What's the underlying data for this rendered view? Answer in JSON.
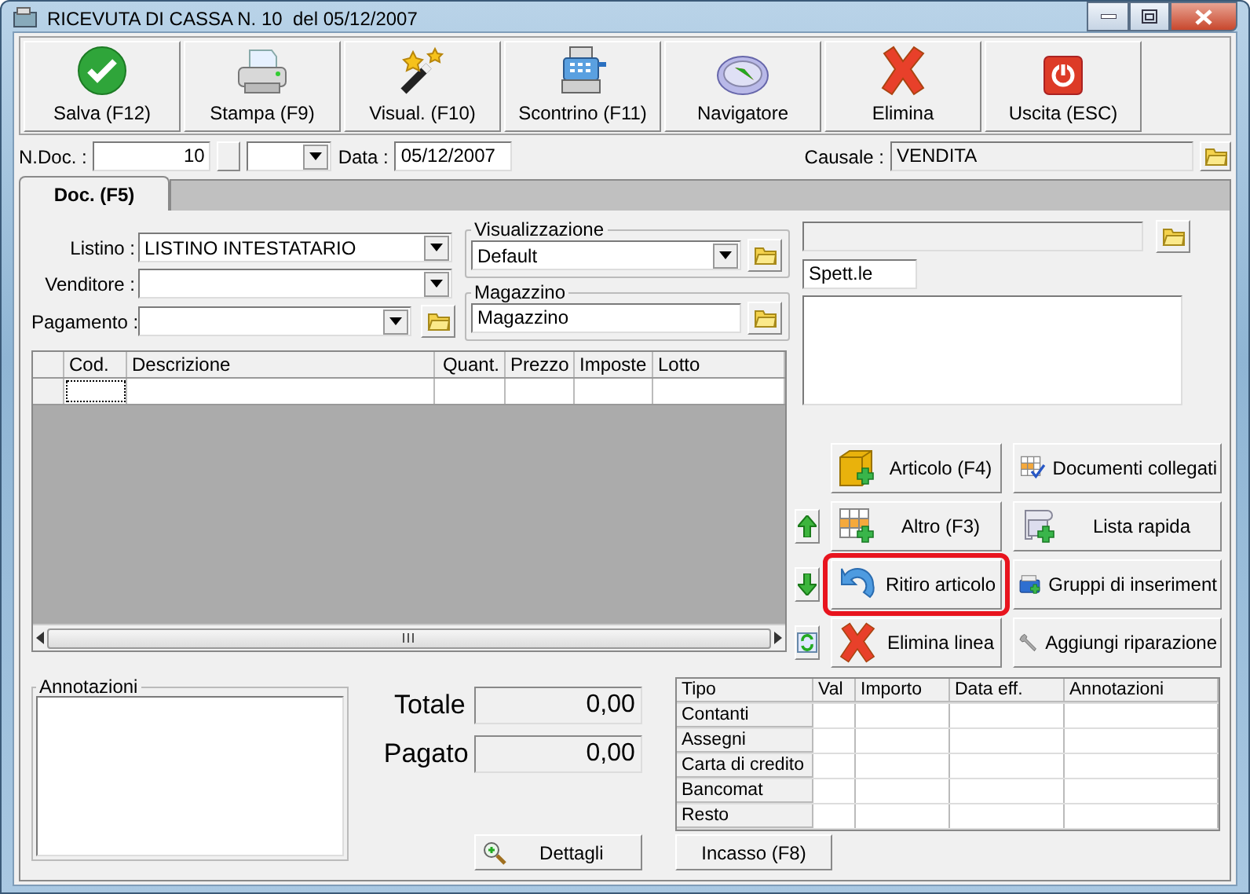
{
  "window": {
    "title": "RICEVUTA DI CASSA N. 10  del 05/12/2007"
  },
  "toolbar": [
    {
      "label": "Salva (F12)"
    },
    {
      "label": "Stampa (F9)"
    },
    {
      "label": "Visual. (F10)"
    },
    {
      "label": "Scontrino (F11)"
    },
    {
      "label": "Navigatore"
    },
    {
      "label": "Elimina"
    },
    {
      "label": "Uscita (ESC)"
    }
  ],
  "header": {
    "ndoc_label": "N.Doc. :",
    "ndoc_value": "10",
    "data_label": "Data :",
    "data_value": "05/12/2007",
    "causale_label": "Causale :",
    "causale_value": "VENDITA"
  },
  "tabs": [
    {
      "label": "Doc. (F5)",
      "selected": true
    }
  ],
  "form": [
    {
      "label": "Listino :",
      "value": "LISTINO INTESTATARIO",
      "folder": false
    },
    {
      "label": "Venditore :",
      "folder": false
    },
    {
      "label": "Pagamento :",
      "folder": true
    }
  ],
  "visualizzazione": {
    "title": "Visualizzazione",
    "value": "Default"
  },
  "magazzino": {
    "title": "Magazzino",
    "value": "Magazzino"
  },
  "recipient": {
    "salutation": "Spett.le"
  },
  "grid": {
    "columns": [
      "Cod.",
      "Descrizione",
      "Quant.",
      "Prezzo",
      "Imposte",
      "Lotto"
    ]
  },
  "actions": [
    {
      "label": "Articolo (F4)",
      "highlighted": false
    },
    {
      "label": "Documenti collegati",
      "highlighted": false
    },
    {
      "label": "Altro (F3)",
      "highlighted": false
    },
    {
      "label": "Lista rapida",
      "highlighted": false
    },
    {
      "label": "Ritiro articolo",
      "highlighted": true
    },
    {
      "label": "Gruppi di inseriment",
      "highlighted": false
    },
    {
      "label": "Elimina linea",
      "highlighted": false
    },
    {
      "label": "Aggiungi riparazione",
      "highlighted": false
    }
  ],
  "annotations": {
    "title": "Annotazioni"
  },
  "totals": [
    {
      "label": "Totale",
      "value": "0,00"
    },
    {
      "label": "Pagato",
      "value": "0,00"
    }
  ],
  "details_button": "Dettagli",
  "payments": {
    "columns": [
      "Tipo",
      "Val",
      "Importo",
      "Data eff.",
      "Annotazioni"
    ],
    "rows": [
      "Contanti",
      "Assegni",
      "Carta di credito",
      "Bancomat",
      "Resto"
    ]
  },
  "incasso_button": "Incasso (F8)"
}
